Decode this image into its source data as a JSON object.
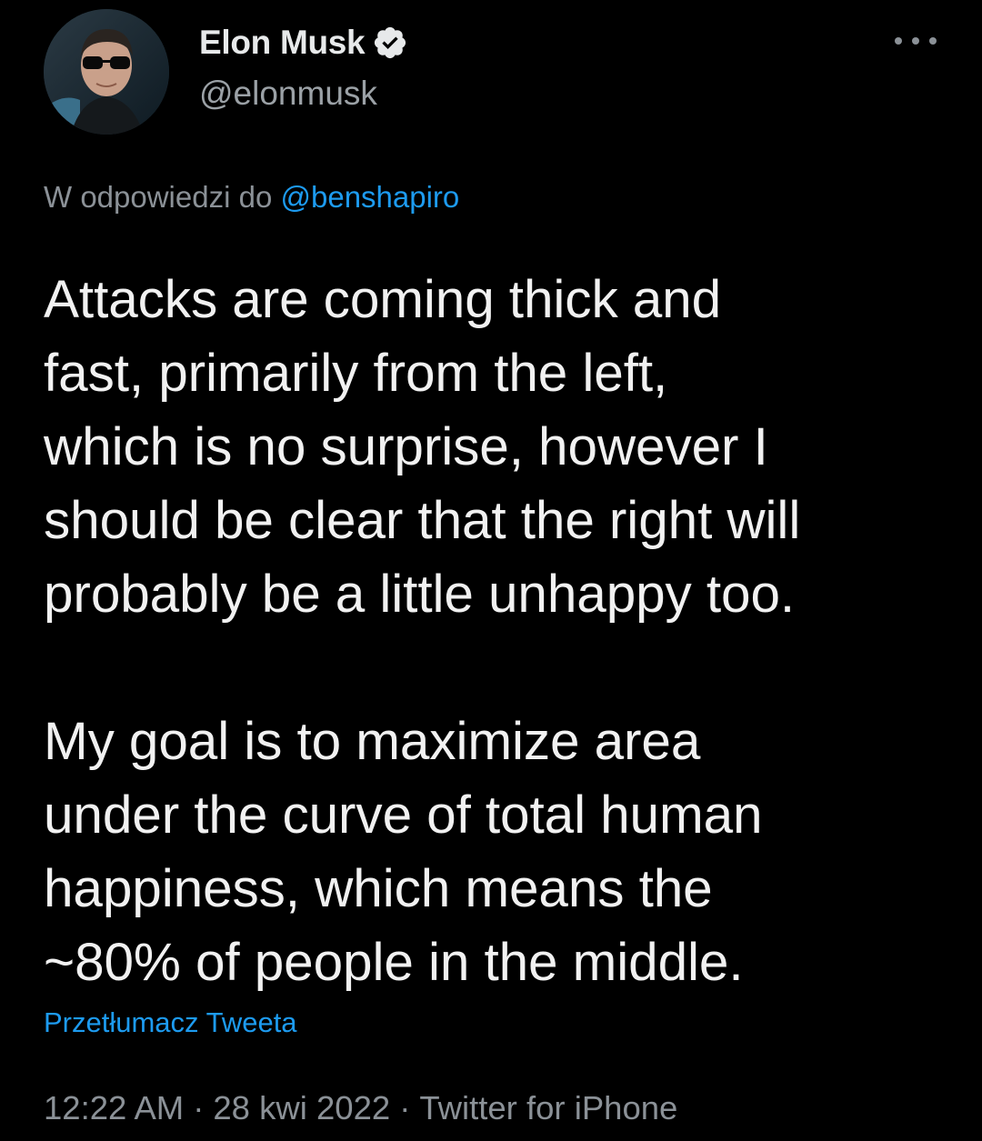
{
  "author": {
    "display_name": "Elon Musk",
    "handle": "@elonmusk",
    "verified": true
  },
  "reply": {
    "prefix": "W odpowiedzi do ",
    "mention": "@benshapiro"
  },
  "tweet": {
    "text": "Attacks are coming thick and\nfast, primarily from the left,\nwhich is no surprise, however I\nshould be clear that the right will\nprobably be a little unhappy too.\n\nMy goal is to maximize area\nunder the curve of total human\nhappiness, which means the\n~80% of people in the middle.",
    "translate_label": "Przetłumacz Tweeta"
  },
  "meta": {
    "time": "12:22 AM",
    "date": "28 kwi 2022",
    "source": "Twitter for iPhone",
    "separator": "·"
  },
  "icons": {
    "verified": "verified-badge-icon",
    "more": "more-options-icon"
  },
  "colors": {
    "background": "#000000",
    "text": "#e7e9ea",
    "secondary": "#8b9197",
    "link": "#1d9bf0"
  }
}
